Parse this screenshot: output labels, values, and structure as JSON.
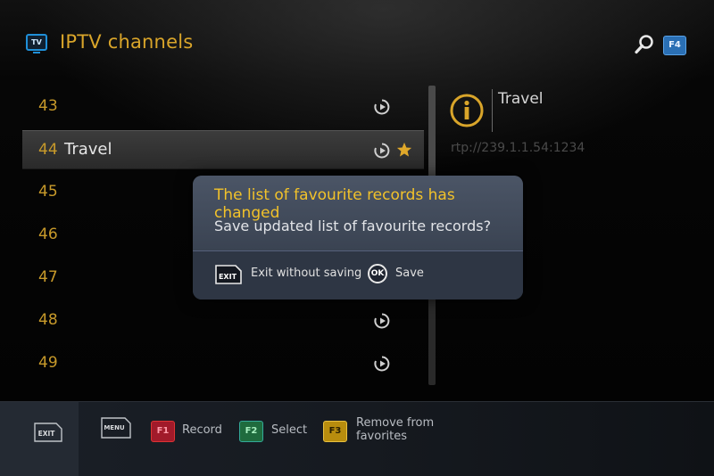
{
  "header": {
    "tv_icon_label": "TV",
    "title": "IPTV channels",
    "search_key": "F4"
  },
  "channels": [
    {
      "number": "43",
      "name": ""
    },
    {
      "number": "44",
      "name": "Travel"
    },
    {
      "number": "45",
      "name": ""
    },
    {
      "number": "46",
      "name": ""
    },
    {
      "number": "47",
      "name": ""
    },
    {
      "number": "48",
      "name": ""
    },
    {
      "number": "49",
      "name": ""
    }
  ],
  "selected_channel_index": 1,
  "info": {
    "title": "Travel",
    "url": "rtp://239.1.1.54:1234"
  },
  "dialog": {
    "title": "The list of favourite records has changed",
    "message": "Save updated list of favourite records?",
    "exit_key": "EXIT",
    "exit_label": "Exit without saving",
    "ok_key": "OK",
    "save_label": "Save"
  },
  "bottom_bar": {
    "exit_key": "EXIT",
    "menu_key": "MENU",
    "f1_key": "F1",
    "f1_label": "Record",
    "f2_key": "F2",
    "f2_label": "Select",
    "f3_key": "F3",
    "f3_label_line1": "Remove from",
    "f3_label_line2": "favorites"
  },
  "colors": {
    "accent": "#d9a52a",
    "dialog_title": "#f2c22a",
    "f1": "#a11a2a",
    "f2": "#1f6b3e",
    "f3": "#b88d0e"
  }
}
